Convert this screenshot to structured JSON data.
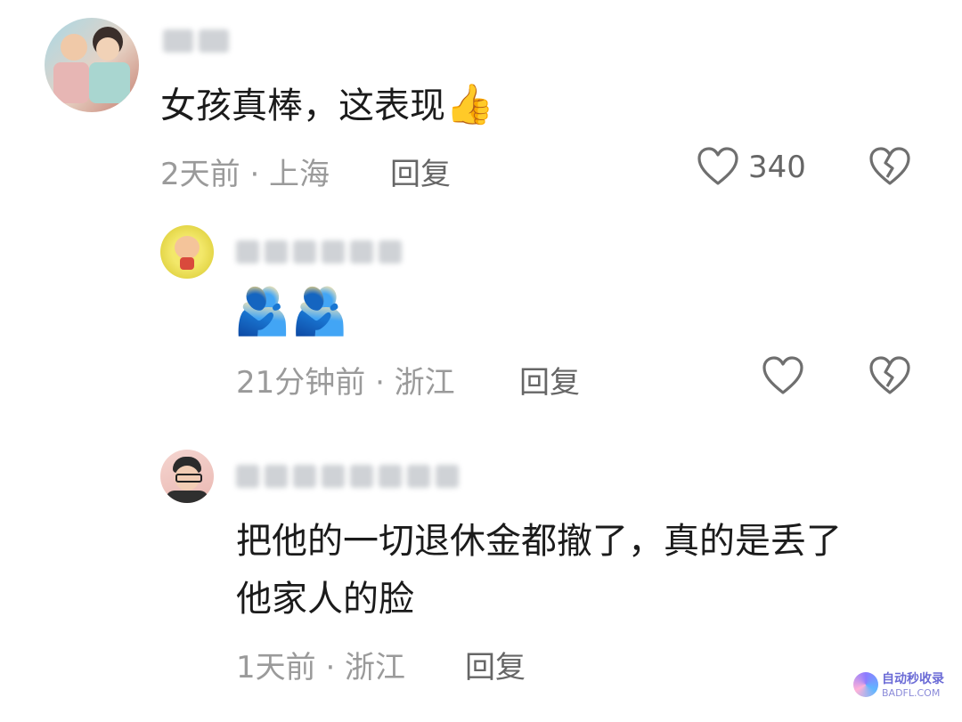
{
  "comments": [
    {
      "text": "女孩真棒，这表现",
      "emoji": "👍",
      "time_location": "2天前 · 上海",
      "reply_label": "回复",
      "like_count": "340"
    },
    {
      "text": "",
      "emoji": "🫂🫂",
      "time_location": "21分钟前 · 浙江",
      "reply_label": "回复",
      "like_count": ""
    },
    {
      "text_line1": "把他的一切退休金都撤了，真的是丢了",
      "text_line2": "他家人的脸",
      "time_location": "1天前 · 浙江",
      "reply_label": "回复"
    }
  ],
  "watermark": {
    "title": "自动秒收录",
    "url": "BADFL.COM"
  },
  "colors": {
    "text": "#1b1b1b",
    "meta": "#9a9a9a",
    "icon": "#6f6f6f"
  }
}
